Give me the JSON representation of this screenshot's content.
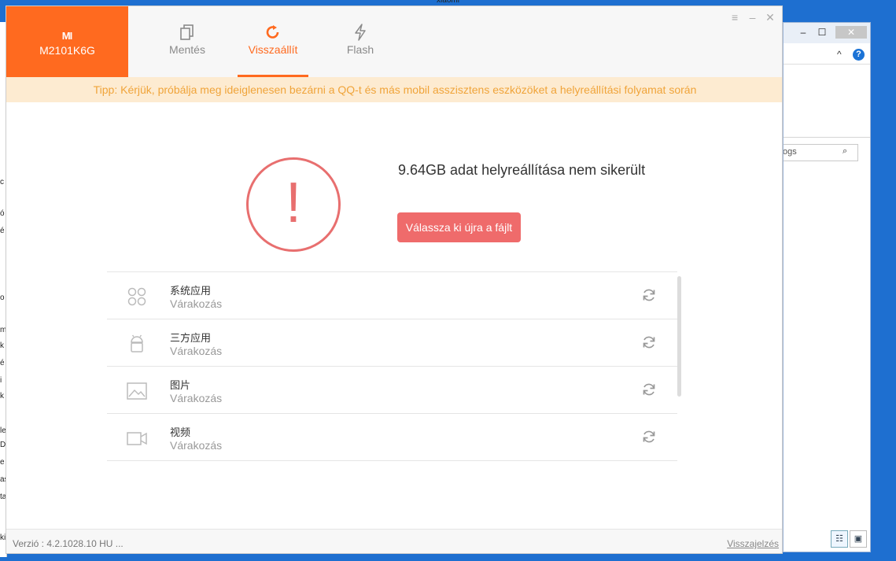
{
  "background": {
    "window_title": "xiaomi",
    "left_strip_chars": [
      "c",
      "ó",
      "é",
      "o",
      "m",
      "k",
      "é",
      "i",
      "k",
      "le",
      "D",
      "e",
      "as",
      "ta",
      "ki"
    ],
    "explorer": {
      "minimize": "–",
      "maximize": "☐",
      "close": "✕",
      "chevron": "^",
      "help": "?",
      "search_text": "ogs",
      "search_icon": "⌕"
    }
  },
  "app": {
    "device": {
      "logo": "MI",
      "name": "M2101K6G"
    },
    "tabs": [
      {
        "label": "Mentés",
        "icon": "copy-icon",
        "active": false
      },
      {
        "label": "Visszaállít",
        "icon": "restore-icon",
        "active": true
      },
      {
        "label": "Flash",
        "icon": "flash-icon",
        "active": false
      }
    ],
    "window_controls": {
      "menu": "≡",
      "minimize": "–",
      "close": "✕"
    },
    "tip": "Tipp: Kérjük, próbálja meg ideiglenesen bezárni a QQ-t és más mobil asszisztens eszközöket a helyreállítási folyamat során",
    "alert_symbol": "!",
    "status_message": "9.64GB adat helyreállítása nem sikerült",
    "retry_button": "Válassza ki újra a fájlt",
    "items": [
      {
        "name": "系统应用",
        "status": "Várakozás",
        "icon": "apps-icon"
      },
      {
        "name": "三方应用",
        "status": "Várakozás",
        "icon": "android-icon"
      },
      {
        "name": "图片",
        "status": "Várakozás",
        "icon": "image-icon"
      },
      {
        "name": "视频",
        "status": "Várakozás",
        "icon": "video-icon"
      }
    ],
    "footer": {
      "version": "Verzió : 4.2.1028.10 HU ...",
      "feedback": "Visszajelzés"
    },
    "colors": {
      "accent": "#ff6a1f",
      "error": "#ef6b6b",
      "tip_bg": "#fdebd1",
      "tip_text": "#f0a43a"
    }
  }
}
